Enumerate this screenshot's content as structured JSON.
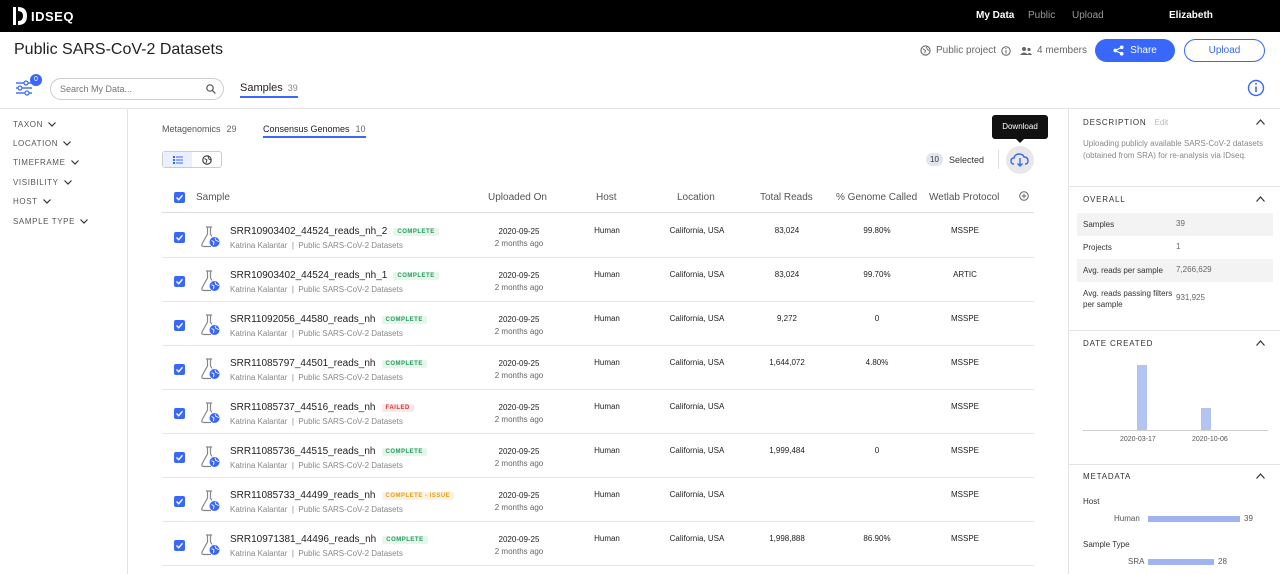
{
  "app": {
    "name": "IDSEQ",
    "nav": [
      {
        "label": "My Data",
        "active": true
      },
      {
        "label": "Public",
        "active": false
      },
      {
        "label": "Upload",
        "active": false
      }
    ],
    "user": "Elizabeth"
  },
  "header": {
    "title": "Public SARS-CoV-2 Datasets",
    "visibility": "Public project",
    "members": "4 members",
    "share_label": "Share",
    "upload_label": "Upload"
  },
  "filters": {
    "badge": "0",
    "search_placeholder": "Search My Data...",
    "samples_tab": {
      "label": "Samples",
      "count": "39"
    },
    "left": [
      "TAXON",
      "LOCATION",
      "TIMEFRAME",
      "VISIBILITY",
      "HOST",
      "SAMPLE TYPE"
    ]
  },
  "subtabs": [
    {
      "label": "Metagenomics",
      "count": "29",
      "active": false
    },
    {
      "label": "Consensus Genomes",
      "count": "10",
      "active": true
    }
  ],
  "selection": {
    "count": "10",
    "label": "Selected",
    "tooltip": "Download"
  },
  "table": {
    "columns": [
      "Sample",
      "Uploaded On",
      "Host",
      "Location",
      "Total Reads",
      "% Genome Called",
      "Wetlab Protocol"
    ],
    "rows": [
      {
        "name": "SRR10903402_44524_reads_nh_2",
        "status": "COMPLETE",
        "status_kind": "complete",
        "user": "Katrina Kalantar",
        "project": "Public SARS-CoV-2 Datasets",
        "date": "2020-09-25",
        "ago": "2 months ago",
        "host": "Human",
        "location": "California, USA",
        "reads": "83,024",
        "genome": "99.80%",
        "protocol": "MSSPE"
      },
      {
        "name": "SRR10903402_44524_reads_nh_1",
        "status": "COMPLETE",
        "status_kind": "complete",
        "user": "Katrina Kalantar",
        "project": "Public SARS-CoV-2 Datasets",
        "date": "2020-09-25",
        "ago": "2 months ago",
        "host": "Human",
        "location": "California, USA",
        "reads": "83,024",
        "genome": "99.70%",
        "protocol": "ARTIC"
      },
      {
        "name": "SRR11092056_44580_reads_nh",
        "status": "COMPLETE",
        "status_kind": "complete",
        "user": "Katrina Kalantar",
        "project": "Public SARS-CoV-2 Datasets",
        "date": "2020-09-25",
        "ago": "2 months ago",
        "host": "Human",
        "location": "California, USA",
        "reads": "9,272",
        "genome": "0",
        "protocol": "MSSPE"
      },
      {
        "name": "SRR11085797_44501_reads_nh",
        "status": "COMPLETE",
        "status_kind": "complete",
        "user": "Katrina Kalantar",
        "project": "Public SARS-CoV-2 Datasets",
        "date": "2020-09-25",
        "ago": "2 months ago",
        "host": "Human",
        "location": "California, USA",
        "reads": "1,644,072",
        "genome": "4.80%",
        "protocol": "MSSPE"
      },
      {
        "name": "SRR11085737_44516_reads_nh",
        "status": "FAILED",
        "status_kind": "failed",
        "user": "Katrina Kalantar",
        "project": "Public SARS-CoV-2 Datasets",
        "date": "2020-09-25",
        "ago": "2 months ago",
        "host": "Human",
        "location": "California, USA",
        "reads": "",
        "genome": "",
        "protocol": "MSSPE"
      },
      {
        "name": "SRR11085736_44515_reads_nh",
        "status": "COMPLETE",
        "status_kind": "complete",
        "user": "Katrina Kalantar",
        "project": "Public SARS-CoV-2 Datasets",
        "date": "2020-09-25",
        "ago": "2 months ago",
        "host": "Human",
        "location": "California, USA",
        "reads": "1,999,484",
        "genome": "0",
        "protocol": "MSSPE"
      },
      {
        "name": "SRR11085733_44499_reads_nh",
        "status": "COMPLETE - ISSUE",
        "status_kind": "issue",
        "user": "Katrina Kalantar",
        "project": "Public SARS-CoV-2 Datasets",
        "date": "2020-09-25",
        "ago": "2 months ago",
        "host": "Human",
        "location": "California, USA",
        "reads": "",
        "genome": "",
        "protocol": "MSSPE"
      },
      {
        "name": "SRR10971381_44496_reads_nh",
        "status": "COMPLETE",
        "status_kind": "complete",
        "user": "Katrina Kalantar",
        "project": "Public SARS-CoV-2 Datasets",
        "date": "2020-09-25",
        "ago": "2 months ago",
        "host": "Human",
        "location": "California, USA",
        "reads": "1,998,888",
        "genome": "86.90%",
        "protocol": "MSSPE"
      }
    ]
  },
  "sidebar": {
    "description": {
      "title": "DESCRIPTION",
      "edit": "Edit",
      "text": "Uploading publicly available SARS-CoV-2 datasets (obtained from SRA) for re-analysis via IDseq."
    },
    "overall": {
      "title": "OVERALL",
      "rows": [
        {
          "label": "Samples",
          "value": "39"
        },
        {
          "label": "Projects",
          "value": "1"
        },
        {
          "label": "Avg. reads per sample",
          "value": "7,266,629"
        },
        {
          "label": "Avg. reads passing filters per sample",
          "value": "931,925"
        }
      ]
    },
    "date_created": {
      "title": "DATE CREATED",
      "tick_labels": [
        "2020-03-17",
        "2020-10-06"
      ],
      "bars": [
        0.95,
        0.33
      ]
    },
    "metadata": {
      "title": "METADATA",
      "host": {
        "label": "Host",
        "category": "Human",
        "count": "39",
        "fraction": 1.0
      },
      "sample_type": {
        "label": "Sample Type",
        "category": "SRA",
        "count": "28",
        "fraction": 0.72
      }
    }
  },
  "colors": {
    "accent": "#3867fa",
    "complete": "#2a9d5c",
    "failed": "#dd3333",
    "issue": "#e89c1a",
    "bar": "#9fb3f0"
  }
}
